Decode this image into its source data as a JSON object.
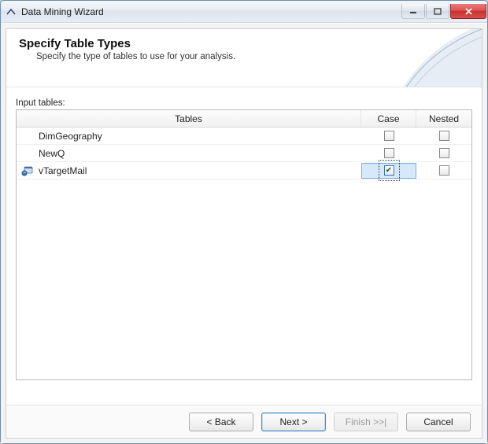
{
  "window": {
    "title": "Data Mining Wizard"
  },
  "header": {
    "heading": "Specify Table Types",
    "subtitle": "Specify the type of tables to use for your analysis."
  },
  "body": {
    "input_tables_label": "Input tables:",
    "columns": {
      "tables": "Tables",
      "case": "Case",
      "nested": "Nested"
    },
    "rows": [
      {
        "name": "DimGeography",
        "has_icon": false,
        "case_checked": false,
        "nested_checked": false,
        "highlight": false
      },
      {
        "name": "NewQ",
        "has_icon": false,
        "case_checked": false,
        "nested_checked": false,
        "highlight": false
      },
      {
        "name": "vTargetMail",
        "has_icon": true,
        "case_checked": true,
        "nested_checked": false,
        "highlight": true
      }
    ]
  },
  "footer": {
    "back": "< Back",
    "next": "Next >",
    "finish": "Finish >>|",
    "cancel": "Cancel"
  }
}
